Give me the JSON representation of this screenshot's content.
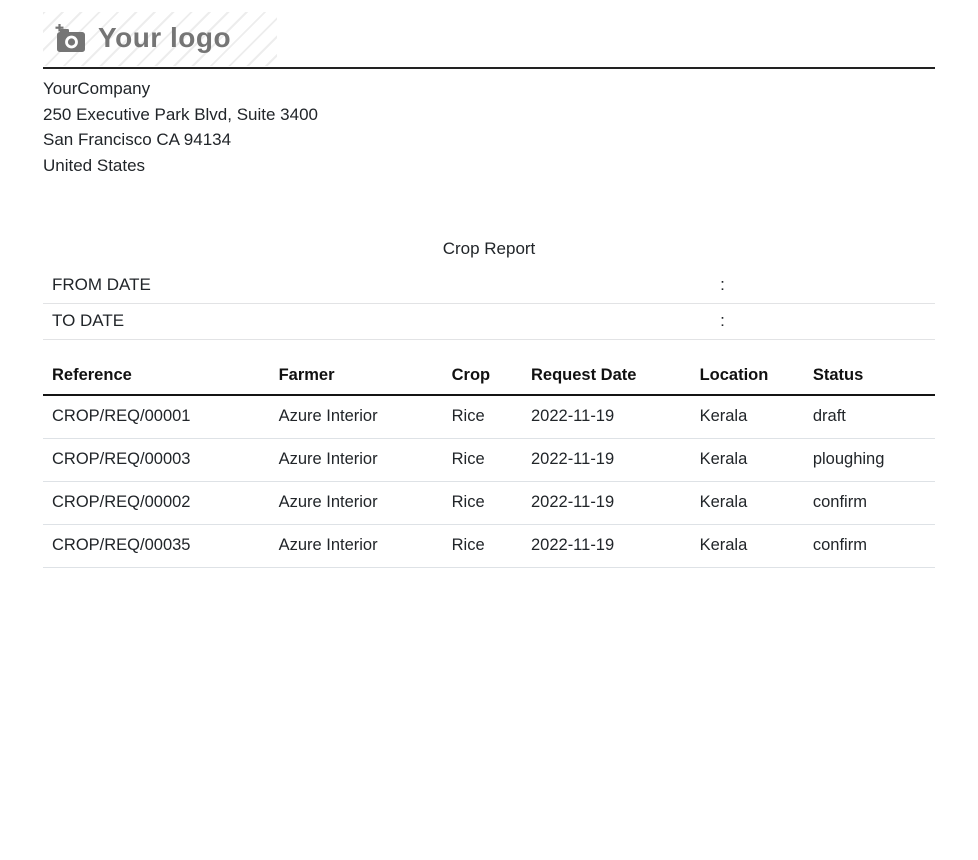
{
  "logo": {
    "text": "Your logo",
    "icon": "camera-plus-icon"
  },
  "company": {
    "name": "YourCompany",
    "address_line1": "250 Executive Park Blvd, Suite 3400",
    "address_line2": "San Francisco CA 94134",
    "address_line3": "United States"
  },
  "report": {
    "title": "Crop Report",
    "filters": [
      {
        "label": "FROM DATE",
        "separator": ":",
        "value": ""
      },
      {
        "label": "TO DATE",
        "separator": ":",
        "value": ""
      }
    ],
    "table": {
      "columns": [
        "Reference",
        "Farmer",
        "Crop",
        "Request Date",
        "Location",
        "Status"
      ],
      "rows": [
        [
          "CROP/REQ/00001",
          "Azure Interior",
          "Rice",
          "2022-11-19",
          "Kerala",
          "draft"
        ],
        [
          "CROP/REQ/00003",
          "Azure Interior",
          "Rice",
          "2022-11-19",
          "Kerala",
          "ploughing"
        ],
        [
          "CROP/REQ/00002",
          "Azure Interior",
          "Rice",
          "2022-11-19",
          "Kerala",
          "confirm"
        ],
        [
          "CROP/REQ/00035",
          "Azure Interior",
          "Rice",
          "2022-11-19",
          "Kerala",
          "confirm"
        ]
      ]
    }
  },
  "colors": {
    "text": "#212529",
    "logo_gray": "#757575",
    "header_rule": "#222222",
    "thead_border": "#141414",
    "row_border": "#dee2e6"
  }
}
